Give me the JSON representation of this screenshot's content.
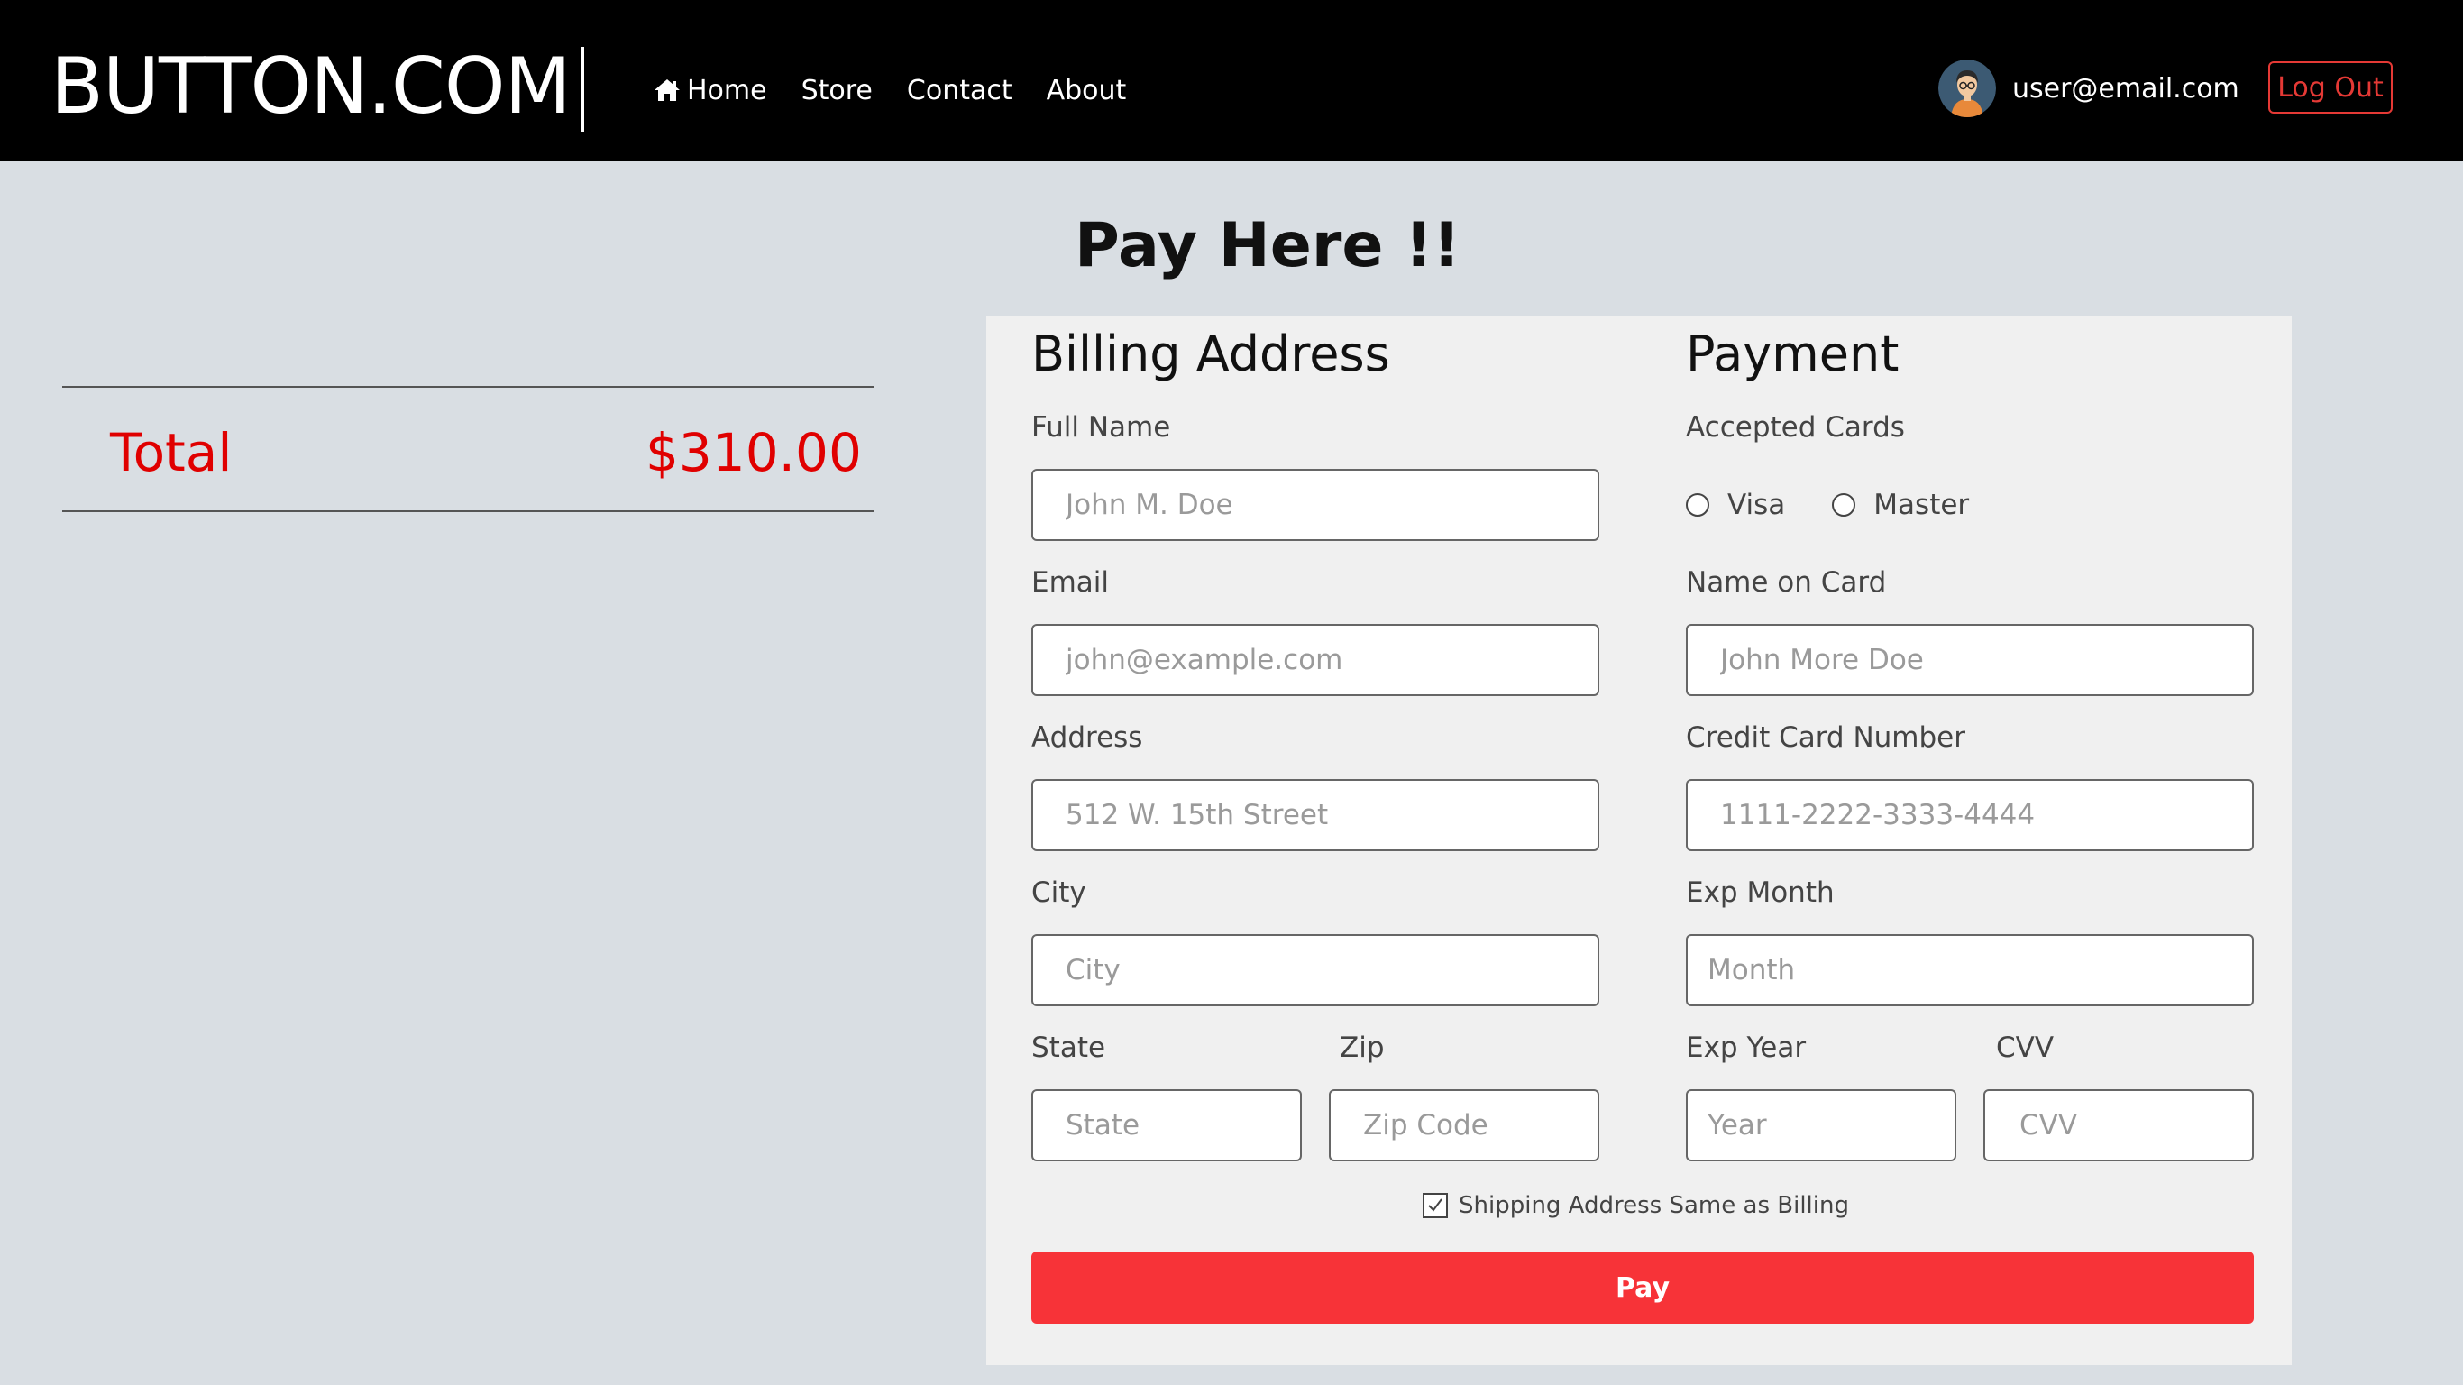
{
  "navbar": {
    "brand": "BUTTON.COM",
    "links": [
      {
        "label": "Home",
        "icon": "home-icon"
      },
      {
        "label": "Store"
      },
      {
        "label": "Contact"
      },
      {
        "label": "About"
      }
    ],
    "user_email": "user@email.com",
    "logout_label": "Log Out"
  },
  "page": {
    "title": "Pay Here !!"
  },
  "summary": {
    "total_label": "Total",
    "total_value": "$310.00"
  },
  "billing": {
    "title": "Billing Address",
    "full_name": {
      "label": "Full Name",
      "placeholder": "John M. Doe"
    },
    "email": {
      "label": "Email",
      "placeholder": "john@example.com"
    },
    "address": {
      "label": "Address",
      "placeholder": "512 W. 15th Street"
    },
    "city": {
      "label": "City",
      "placeholder": "City"
    },
    "state": {
      "label": "State",
      "placeholder": "State"
    },
    "zip": {
      "label": "Zip",
      "placeholder": "Zip Code"
    }
  },
  "payment": {
    "title": "Payment",
    "accepted_cards_label": "Accepted Cards",
    "cards": [
      "Visa",
      "Master"
    ],
    "name_on_card": {
      "label": "Name on Card",
      "placeholder": "John More Doe"
    },
    "card_number": {
      "label": "Credit Card Number",
      "placeholder": "1111-2222-3333-4444"
    },
    "exp_month": {
      "label": "Exp Month",
      "placeholder": "Month"
    },
    "exp_year": {
      "label": "Exp Year",
      "placeholder": "Year"
    },
    "cvv": {
      "label": "CVV",
      "placeholder": "CVV"
    }
  },
  "shipping_same": {
    "label": "Shipping Address Same as Billing",
    "checked": true
  },
  "pay_button": "Pay",
  "colors": {
    "navbar_bg": "#000000",
    "page_bg": "#d9dee3",
    "card_bg": "#f0f0f0",
    "accent_red": "#e00000",
    "pay_button": "#f73338"
  }
}
